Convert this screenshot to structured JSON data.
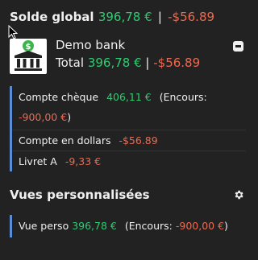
{
  "header": {
    "title": "Solde global",
    "balance": "396,78 €",
    "separator": "|",
    "pending": "-$56.89"
  },
  "bank": {
    "icon": "bank-dollar-icon",
    "name": "Demo bank",
    "total_label": "Total",
    "total_balance": "396,78 €",
    "separator": "|",
    "total_pending": "-$56.89",
    "collapse_icon": "minus-square-icon"
  },
  "accounts": [
    {
      "name": "Compte chèque",
      "balance": "406,11 €",
      "encours_label": "(Encours:",
      "encours_value": "-900,00 €",
      "encours_close": ")"
    },
    {
      "name": "Compte en dollars",
      "balance": "-$56.89"
    },
    {
      "name": "Livret A",
      "balance": "-9,33 €"
    }
  ],
  "custom_views": {
    "title": "Vues personnalisées",
    "settings_icon": "gear-icon",
    "items": [
      {
        "name": "Vue perso",
        "balance": "396,78 €",
        "encours_label": "(Encours:",
        "encours_value": "-900,00 €",
        "encours_close": ")"
      }
    ]
  },
  "colors": {
    "background": "#222222",
    "positive": "#2ecc71",
    "negative": "#ec6a50",
    "accent_border": "#5b8dd6"
  }
}
